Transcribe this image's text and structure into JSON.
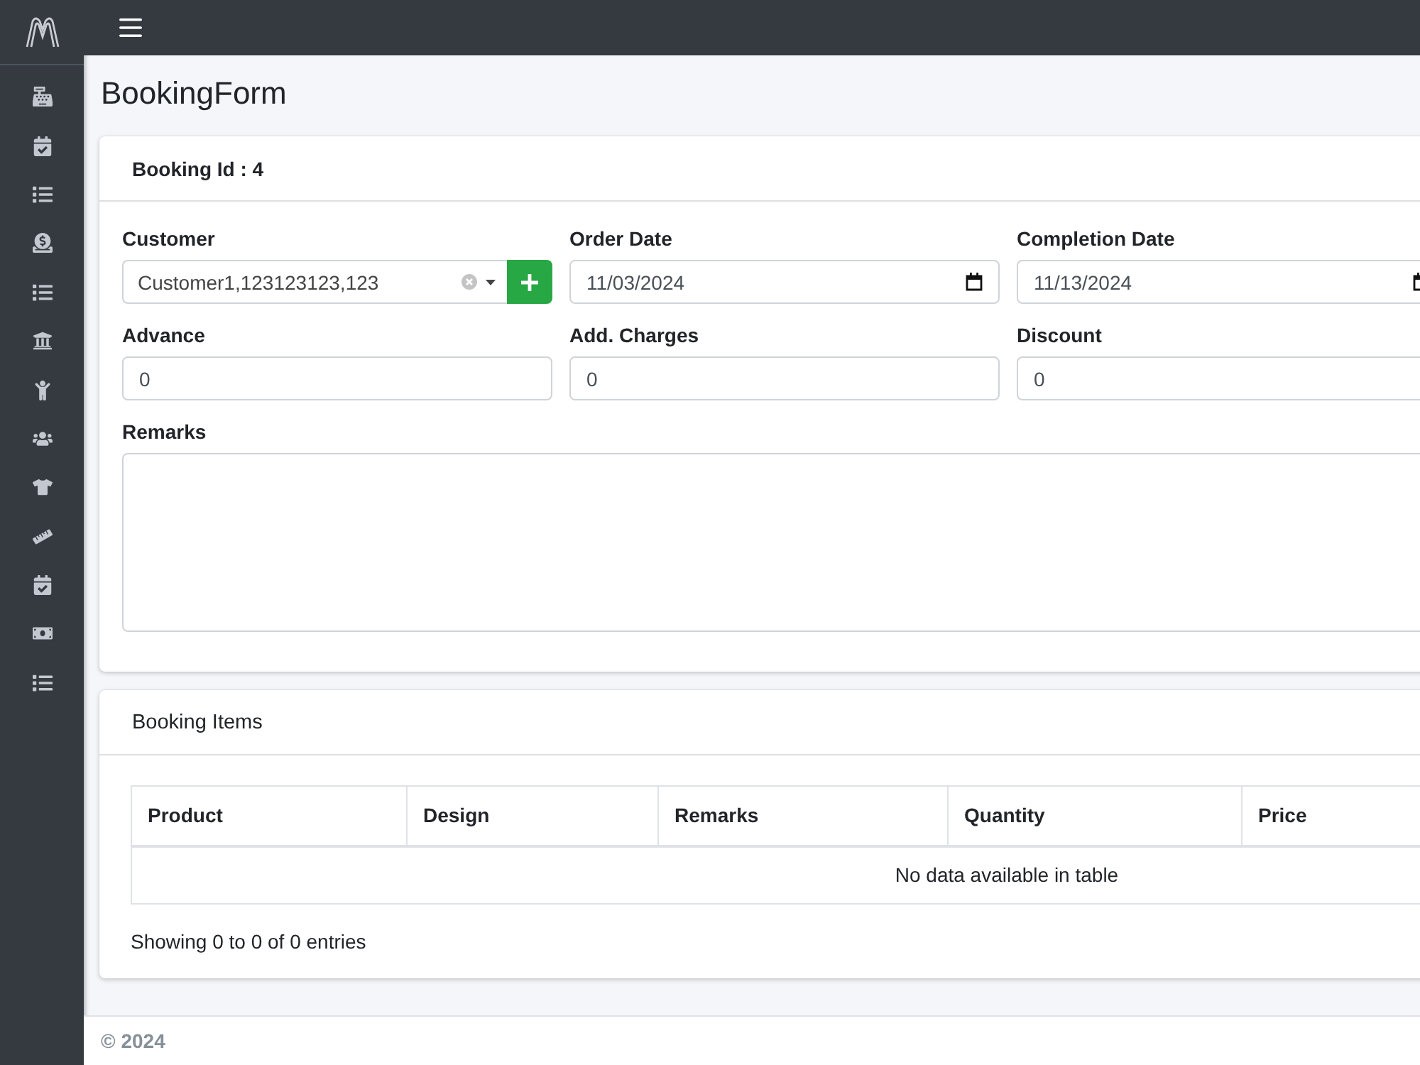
{
  "sidebar": {
    "items": [
      {
        "kind": "register"
      },
      {
        "kind": "calendar"
      },
      {
        "kind": "list"
      },
      {
        "kind": "donate"
      },
      {
        "kind": "list"
      },
      {
        "kind": "bank"
      },
      {
        "kind": "person"
      },
      {
        "kind": "group"
      },
      {
        "kind": "shirt"
      },
      {
        "kind": "ruler"
      },
      {
        "kind": "calendar"
      },
      {
        "kind": "money"
      },
      {
        "kind": "list"
      }
    ]
  },
  "page": {
    "title": "BookingForm"
  },
  "booking_card": {
    "title": "Booking Id : 4",
    "fields": [
      {
        "kind": "select",
        "label": "Customer",
        "value": "Customer1,123123123,123"
      },
      {
        "kind": "date",
        "label": "Order Date",
        "value": "11/03/2024"
      },
      {
        "kind": "date",
        "label": "Completion Date",
        "value": "11/13/2024"
      },
      {
        "kind": "text",
        "label": "Advance",
        "value": "0"
      },
      {
        "kind": "text",
        "label": "Add. Charges",
        "value": "0"
      },
      {
        "kind": "text",
        "label": "Discount",
        "value": "0"
      },
      {
        "kind": "textarea",
        "label": "Remarks"
      }
    ]
  },
  "items_card": {
    "title": "Booking Items",
    "table": {
      "columns": [
        "Product",
        "Design",
        "Remarks",
        "Quantity",
        "Price"
      ],
      "empty_message": "No data available in table"
    },
    "info": "Showing 0 to 0 of 0 entries"
  },
  "footer": {
    "text": "© 2024"
  }
}
